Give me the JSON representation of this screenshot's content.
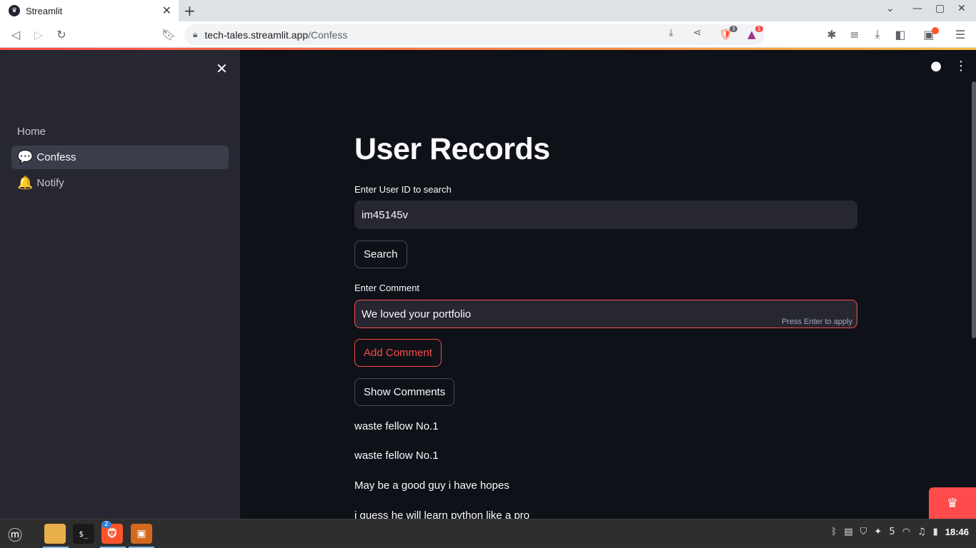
{
  "browser": {
    "tab_title": "Streamlit",
    "url_host": "tech-tales.streamlit.app",
    "url_path": "/Confess",
    "brave_shield_count": "3",
    "rewards_count": "1"
  },
  "sidebar": {
    "items": [
      {
        "label": "Home",
        "emoji": ""
      },
      {
        "label": "Confess",
        "emoji": "💬"
      },
      {
        "label": "Notify",
        "emoji": "🔔"
      }
    ]
  },
  "main": {
    "title": "User Records",
    "user_id_label": "Enter User ID to search",
    "user_id_value": "im45145v",
    "search_button": "Search",
    "comment_label": "Enter Comment",
    "comment_value": "We loved your portfolio",
    "comment_hint": "Press Enter to apply",
    "add_comment_button": "Add Comment",
    "show_comments_button": "Show Comments",
    "comments": [
      "waste fellow No.1",
      "waste fellow No.1",
      "May be a good guy i have hopes",
      "i guess he will learn python like a pro"
    ]
  },
  "taskbar": {
    "brave_badge": "2",
    "tray_count": "5",
    "clock": "18:46"
  },
  "colors": {
    "accent": "#ff4b4b",
    "sidebar_bg": "#262730",
    "main_bg": "#0e1117"
  }
}
